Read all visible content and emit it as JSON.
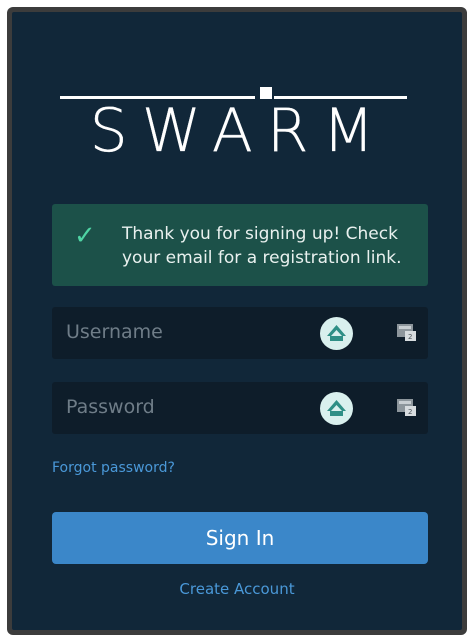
{
  "logo": {
    "text": "SWARM"
  },
  "banner": {
    "icon": "checkmark-icon",
    "message": "Thank you for signing up! Check your email for a registration link."
  },
  "fields": {
    "username": {
      "placeholder": "Username",
      "value": ""
    },
    "password": {
      "placeholder": "Password",
      "value": ""
    }
  },
  "links": {
    "forgot": "Forgot password?",
    "create": "Create Account"
  },
  "buttons": {
    "signin": "Sign In"
  },
  "colors": {
    "panel": "#112739",
    "banner": "#1c5149",
    "check": "#4fd4a4",
    "primary": "#3b87c9",
    "link": "#4a98d8"
  }
}
